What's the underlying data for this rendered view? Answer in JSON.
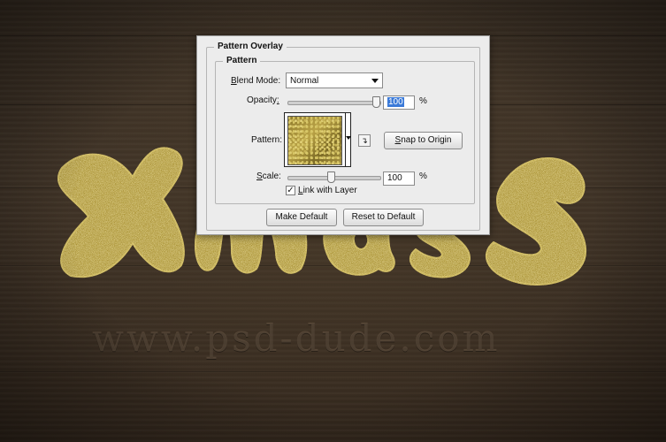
{
  "watermark": "www.psd-dude.com",
  "dialog": {
    "title": "Pattern Overlay",
    "section": "Pattern",
    "blend_mode": {
      "label_first": "B",
      "label_rest": "lend Mode:",
      "value": "Normal"
    },
    "opacity": {
      "label_rest": "Opacity",
      "label_hot": ":",
      "value": "100",
      "unit": "%",
      "level": 1.0
    },
    "pattern": {
      "label": "Pattern:"
    },
    "snap_button": {
      "label_first": "S",
      "label_rest": "nap to Origin"
    },
    "scale": {
      "label_first": "S",
      "label_rest": "cale:",
      "value": "100",
      "unit": "%",
      "level": 0.38
    },
    "link": {
      "checked": true,
      "check_mark": "✓",
      "label_first": "L",
      "label_rest": "ink with Layer"
    },
    "make_default_label": "Make Default",
    "reset_default_label": "Reset to Default",
    "new_preset_glyph": "↴"
  },
  "colors": {
    "glitter_gold": "#b9a23f",
    "dialog_bg": "#ececec",
    "selection_blue": "#3b7ad8"
  },
  "icons": [
    "dropdown-caret-icon",
    "new-preset-icon",
    "checkmark-icon"
  ]
}
